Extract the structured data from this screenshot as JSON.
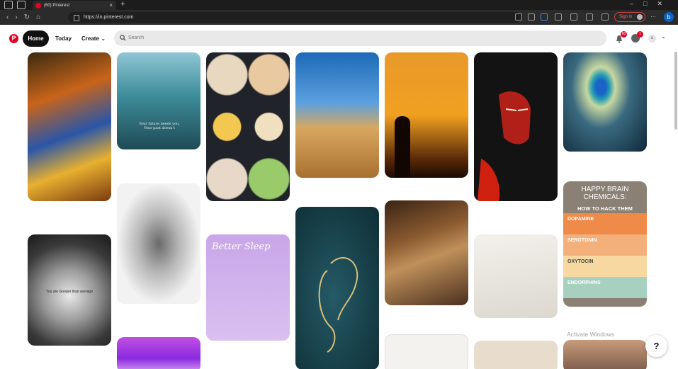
{
  "browser": {
    "tab_title": "(60) Pinterest",
    "url": "https://in.pinterest.com",
    "signin_label": "Sign in"
  },
  "pinterest": {
    "nav": {
      "home": "Home",
      "today": "Today",
      "create": "Create"
    },
    "search_placeholder": "Search",
    "notifications_badge": "60",
    "messages_badge": "1",
    "avatar_initial": "c"
  },
  "pins": [
    {
      "name": "krishna-flute-art"
    },
    {
      "name": "girl-lake-quote",
      "caption": "Your future needs you, Your past doesn't"
    },
    {
      "name": "meal-prep-plates"
    },
    {
      "name": "temple-somnath"
    },
    {
      "name": "silhouette-sunset"
    },
    {
      "name": "hanuman-red-art"
    },
    {
      "name": "peacock-feather"
    },
    {
      "name": "sketch-warrior-tattoo"
    },
    {
      "name": "happy-brain-chemicals",
      "title": "HAPPY BRAIN CHEMICALS:",
      "subtitle": "HOW TO HACK THEM",
      "rows": [
        "DOPAMINE",
        "SEROTONIN",
        "OXYTOCIN",
        "ENDORPHINS"
      ]
    },
    {
      "name": "math-keychain",
      "caption": "You are Greater than average"
    },
    {
      "name": "better-sleep-yoga",
      "title": "Better Sleep"
    },
    {
      "name": "ganesha-teal"
    },
    {
      "name": "house-interior"
    },
    {
      "name": "math-notebook"
    },
    {
      "name": "purple-gradient"
    },
    {
      "name": "floor-plan"
    },
    {
      "name": "beige-card"
    },
    {
      "name": "woman-portrait"
    }
  ],
  "overlay": {
    "activate_text": "Activate Windows",
    "help": "?"
  }
}
